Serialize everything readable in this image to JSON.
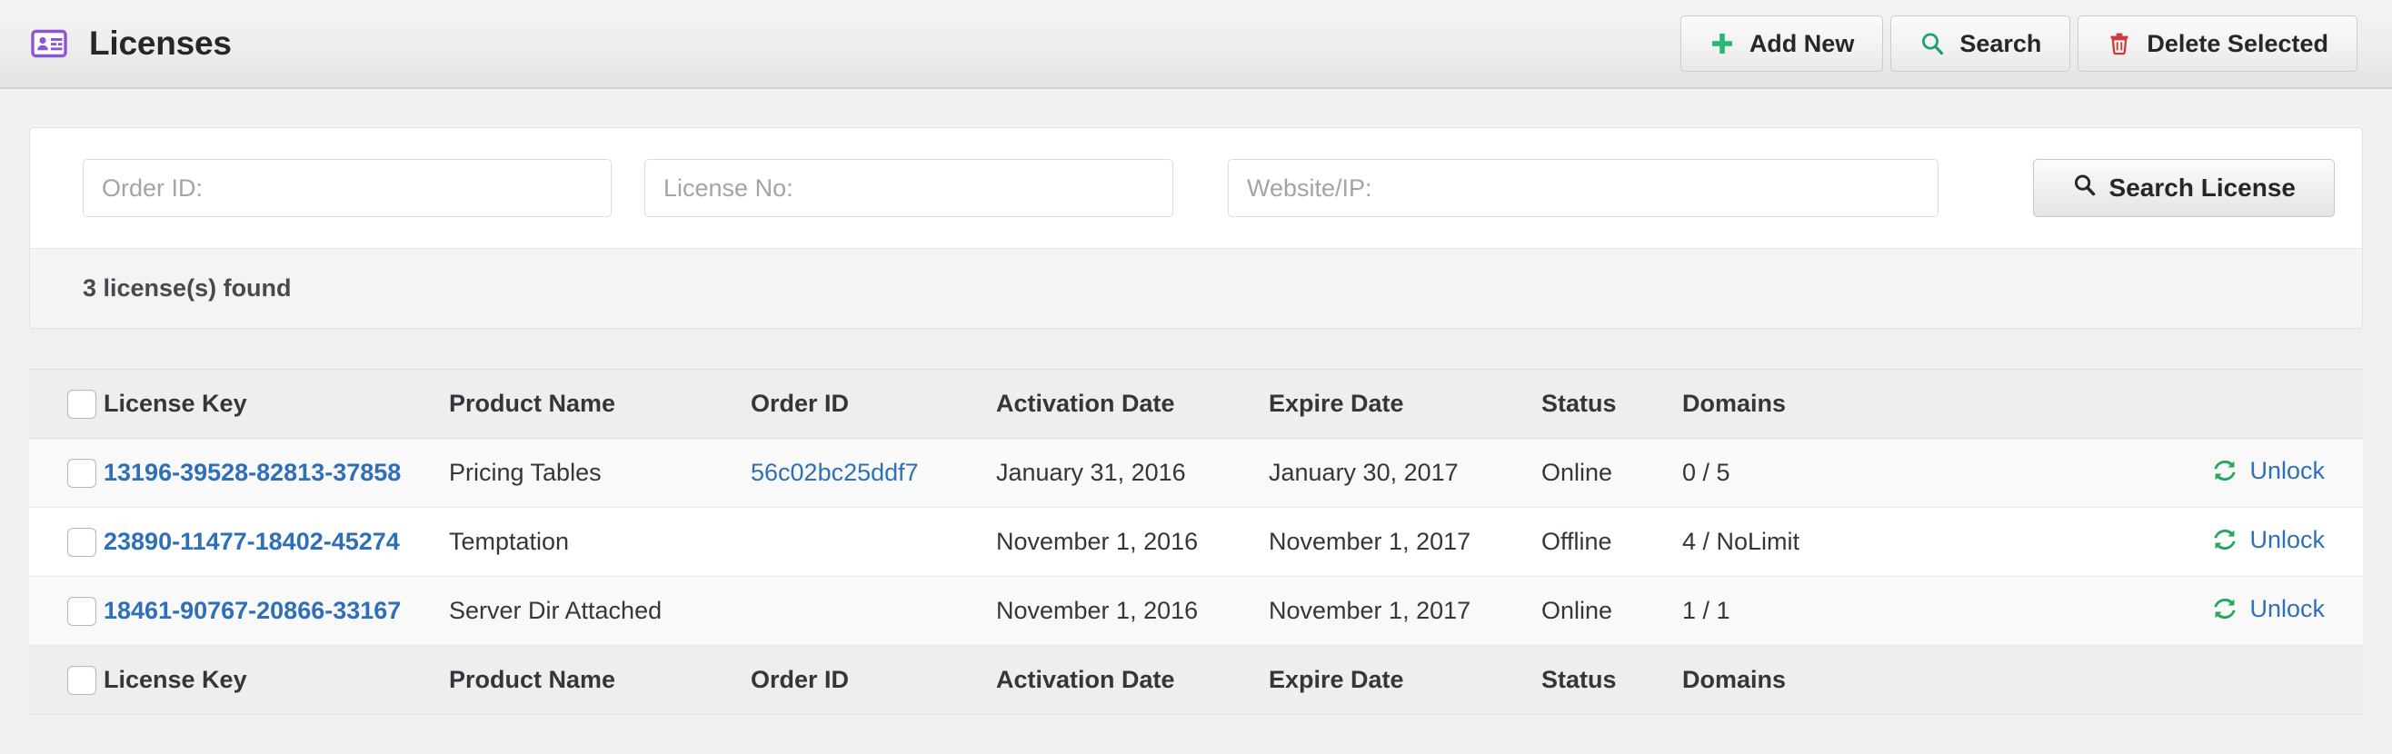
{
  "header": {
    "icon": "id-card-icon",
    "title": "Licenses",
    "icon_color": "#8c54d6",
    "buttons": [
      {
        "label": "Add New",
        "icon": "plus-icon",
        "icon_color": "#2bb673"
      },
      {
        "label": "Search",
        "icon": "search-icon",
        "icon_color": "#22a06b"
      },
      {
        "label": "Delete Selected",
        "icon": "trash-icon",
        "icon_color": "#cc3b3b"
      }
    ]
  },
  "filters": {
    "order_id": {
      "placeholder": "Order ID:",
      "value": ""
    },
    "license_no": {
      "placeholder": "License No:",
      "value": ""
    },
    "website_ip": {
      "placeholder": "Website/IP:",
      "value": ""
    },
    "search_button": {
      "label": "Search License",
      "icon": "search-icon"
    },
    "results_summary": "3 license(s) found"
  },
  "table": {
    "columns": [
      "License Key",
      "Product Name",
      "Order ID",
      "Activation Date",
      "Expire Date",
      "Status",
      "Domains"
    ],
    "action_label": "Unlock",
    "action_icon": "refresh-icon",
    "action_icon_color": "#26a65b",
    "link_color": "#2e6fb7",
    "rows": [
      {
        "license_key": "13196-39528-82813-37858",
        "product_name": "Pricing Tables",
        "order_id": "56c02bc25ddf7",
        "activation_date": "January 31, 2016",
        "expire_date": "January 30, 2017",
        "status": "Online",
        "domains": "0 / 5",
        "action": "Unlock"
      },
      {
        "license_key": "23890-11477-18402-45274",
        "product_name": "Temptation",
        "order_id": "",
        "activation_date": "November 1, 2016",
        "expire_date": "November 1, 2017",
        "status": "Offline",
        "domains": "4 / NoLimit",
        "action": "Unlock"
      },
      {
        "license_key": "18461-90767-20866-33167",
        "product_name": "Server Dir Attached",
        "order_id": "",
        "activation_date": "November 1, 2016",
        "expire_date": "November 1, 2017",
        "status": "Online",
        "domains": "1 / 1",
        "action": "Unlock"
      }
    ]
  }
}
